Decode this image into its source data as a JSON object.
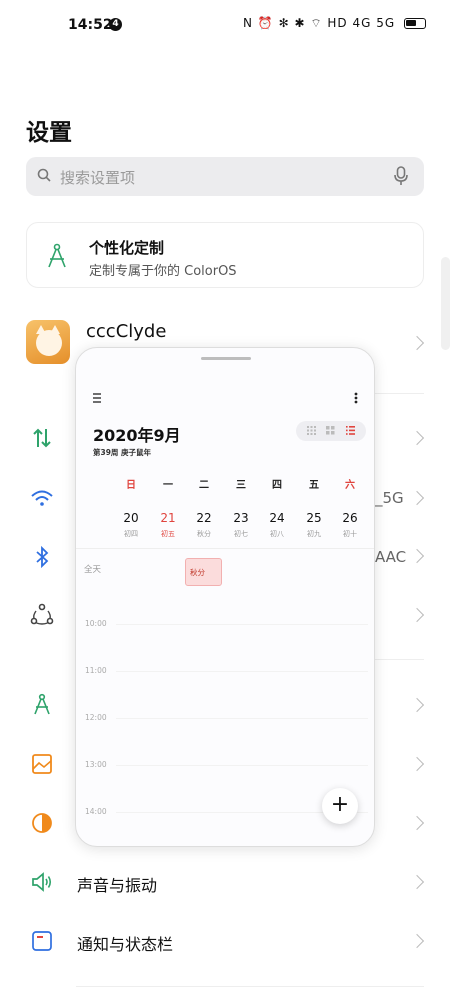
{
  "status_bar": {
    "time": "14:52",
    "notification_count": "4",
    "signal_labels": "N ⏰ ✻ ✱ ⌔ HD 4G 5G"
  },
  "page": {
    "title": "设置"
  },
  "search": {
    "placeholder": "搜索设置项"
  },
  "personalize_card": {
    "title": "个性化定制",
    "subtitle": "定制专属于你的 ColorOS"
  },
  "account": {
    "name": "cccClyde"
  },
  "partial_values": {
    "wifi_suffix": "_5G",
    "bluetooth_suffix": "AAC"
  },
  "settings_rows": [
    {
      "label": "声音与振动",
      "icon": "speaker-icon"
    },
    {
      "label": "通知与状态栏",
      "icon": "notification-icon"
    }
  ],
  "calendar": {
    "month_title": "2020年9月",
    "week_info": "第39周 庚子鼠年",
    "weekdays": [
      "日",
      "一",
      "二",
      "三",
      "四",
      "五",
      "六"
    ],
    "days": [
      {
        "num": "20",
        "lunar": "初四"
      },
      {
        "num": "21",
        "lunar": "初五"
      },
      {
        "num": "22",
        "lunar": "秋分"
      },
      {
        "num": "23",
        "lunar": "初七"
      },
      {
        "num": "24",
        "lunar": "初八"
      },
      {
        "num": "25",
        "lunar": "初九"
      },
      {
        "num": "26",
        "lunar": "初十"
      }
    ],
    "all_day_label": "全天",
    "all_day_event": "秋分",
    "hours": [
      "10:00",
      "11:00",
      "12:00",
      "13:00",
      "14:00"
    ],
    "add_label": "+"
  },
  "colors": {
    "accent_green": "#2fa36b",
    "accent_blue": "#2f6fe0",
    "accent_red": "#e0443e",
    "accent_orange": "#f08a1c"
  }
}
